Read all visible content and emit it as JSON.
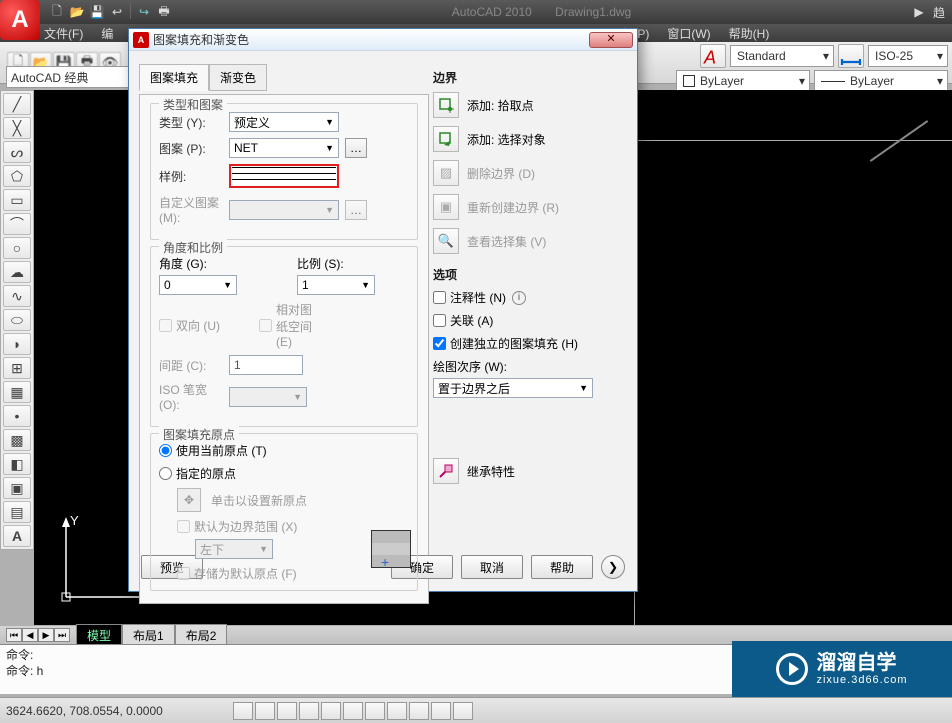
{
  "title": {
    "app": "AutoCAD 2010",
    "doc": "Drawing1.dwg"
  },
  "menu": {
    "file": "文件(F)",
    "edit": "编",
    "numbers": "数(P)",
    "window": "窗口(W)",
    "help": "帮助(H)"
  },
  "workspace": "AutoCAD 经典",
  "styles": {
    "text": "Standard",
    "dim": "ISO-25",
    "color": "ByLayer",
    "linetype": "ByLayer"
  },
  "tabs": {
    "model": "模型",
    "layout1": "布局1",
    "layout2": "布局2"
  },
  "command": {
    "line1": "命令:",
    "line2_prefix": "命令: ",
    "line2_val": "h"
  },
  "status": {
    "coords": "3624.6620, 708.0554, 0.0000"
  },
  "watermark": {
    "big": "溜溜自学",
    "small": "zixue.3d66.com"
  },
  "dialog": {
    "title": "图案填充和渐变色",
    "close": "✕",
    "tabs": {
      "hatch": "图案填充",
      "grad": "渐变色"
    },
    "type_group": {
      "title": "类型和图案",
      "type_lbl": "类型 (Y):",
      "type_val": "预定义",
      "pattern_lbl": "图案 (P):",
      "pattern_val": "NET",
      "sample_lbl": "样例:",
      "custom_lbl": "自定义图案 (M):"
    },
    "angle_group": {
      "title": "角度和比例",
      "angle_lbl": "角度 (G):",
      "angle_val": "0",
      "scale_lbl": "比例 (S):",
      "scale_val": "1",
      "double_lbl": "双向 (U)",
      "rel_paper_lbl": "相对图纸空间 (E)",
      "spacing_lbl": "间距 (C):",
      "spacing_val": "1",
      "iso_lbl": "ISO 笔宽 (O):"
    },
    "origin_group": {
      "title": "图案填充原点",
      "use_current": "使用当前原点 (T)",
      "specified": "指定的原点",
      "click_set": "单击以设置新原点",
      "default_ext": "默认为边界范围 (X)",
      "pos_val": "左下",
      "store_default": "存储为默认原点 (F)"
    },
    "boundary": {
      "title": "边界",
      "add_pick": "添加: 拾取点",
      "add_select": "添加: 选择对象",
      "remove": "删除边界 (D)",
      "recreate": "重新创建边界 (R)",
      "view_sel": "查看选择集 (V)"
    },
    "options": {
      "title": "选项",
      "annotative": "注释性 (N)",
      "assoc": "关联 (A)",
      "independent": "创建独立的图案填充 (H)",
      "draw_order_lbl": "绘图次序 (W):",
      "draw_order_val": "置于边界之后"
    },
    "inherit": "继承特性",
    "preview": "预览",
    "ok": "确定",
    "cancel": "取消",
    "help": "帮助"
  }
}
